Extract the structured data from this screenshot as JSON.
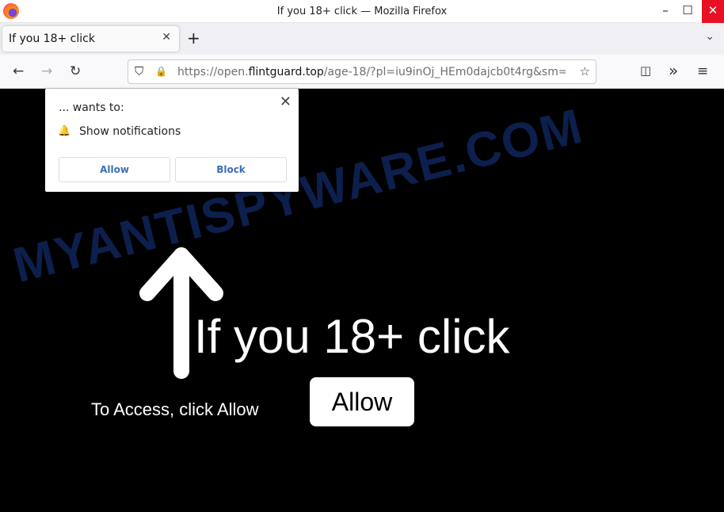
{
  "window": {
    "title": "If you 18+ click — Mozilla Firefox",
    "minimize": "–",
    "maximize": "☐",
    "close": "✕"
  },
  "tab": {
    "label": "If you 18+ click",
    "close": "✕",
    "new_tab": "+",
    "list": "⌄"
  },
  "nav": {
    "back": "←",
    "forward": "→",
    "reload": "↻",
    "url_prefix": "https://open.",
    "url_domain": "flintguard.top",
    "url_rest": "/age-18/?pl=iu9inOj_HEm0dajcb0t4rg&sm=",
    "pocket": "◫",
    "extensions": "»",
    "menu": "≡",
    "shield": "⛉",
    "lock": "🔒",
    "star": "☆"
  },
  "popup": {
    "wants": "... wants to:",
    "permission": "Show notifications",
    "allow": "Allow",
    "block": "Block",
    "close": "✕",
    "bell": "🔔"
  },
  "page": {
    "headline": "If you 18+ click",
    "instruction": "To Access, click Allow",
    "allow_button": "Allow"
  },
  "watermark": "MYANTISPYWARE.COM"
}
